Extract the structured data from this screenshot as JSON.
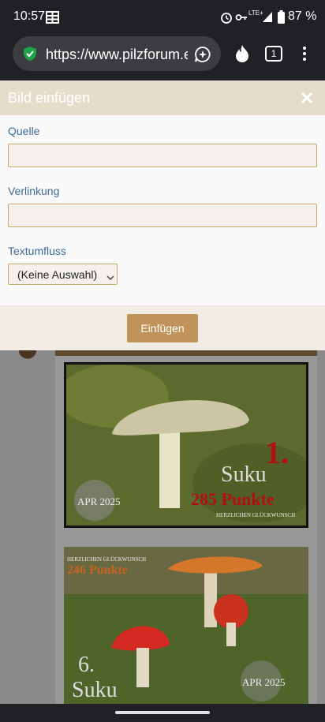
{
  "status_bar": {
    "time": "10:57",
    "network": "LTE+",
    "battery": "87 %",
    "icons": [
      "grid-icon",
      "alarm-icon",
      "key-icon",
      "signal-icon",
      "battery-icon"
    ]
  },
  "browser": {
    "url": "https://www.pilzforum.e",
    "tab_count": "1",
    "icons": [
      "secure-shield-icon",
      "assistant-icon",
      "fire-icon",
      "tabs-icon",
      "more-menu-icon"
    ]
  },
  "dialog": {
    "title": "Bild einfügen",
    "fields": [
      {
        "label": "Quelle",
        "value": ""
      },
      {
        "label": "Verlinkung",
        "value": ""
      }
    ],
    "wrap": {
      "label": "Textumfluss",
      "selected": "(Keine Auswahl)"
    },
    "submit_label": "Einfügen",
    "colors": {
      "title_bar": "#e6dccb",
      "label": "#3d6b97",
      "field_border": "#c9a86a",
      "button": "#c0935a"
    }
  },
  "background": {
    "photo1": {
      "name": "Suku",
      "points": "285 Punkte",
      "rank": "1.",
      "greeting": "HERZLICHEN GLÜCKWUNSCH",
      "badge": "APR 2025"
    },
    "photo2": {
      "name": "Suku",
      "points": "246 Punkte",
      "rank": "6.",
      "greeting": "HERZLICHEN GLÜCKWUNSCH",
      "badge": "APR 2025"
    }
  }
}
